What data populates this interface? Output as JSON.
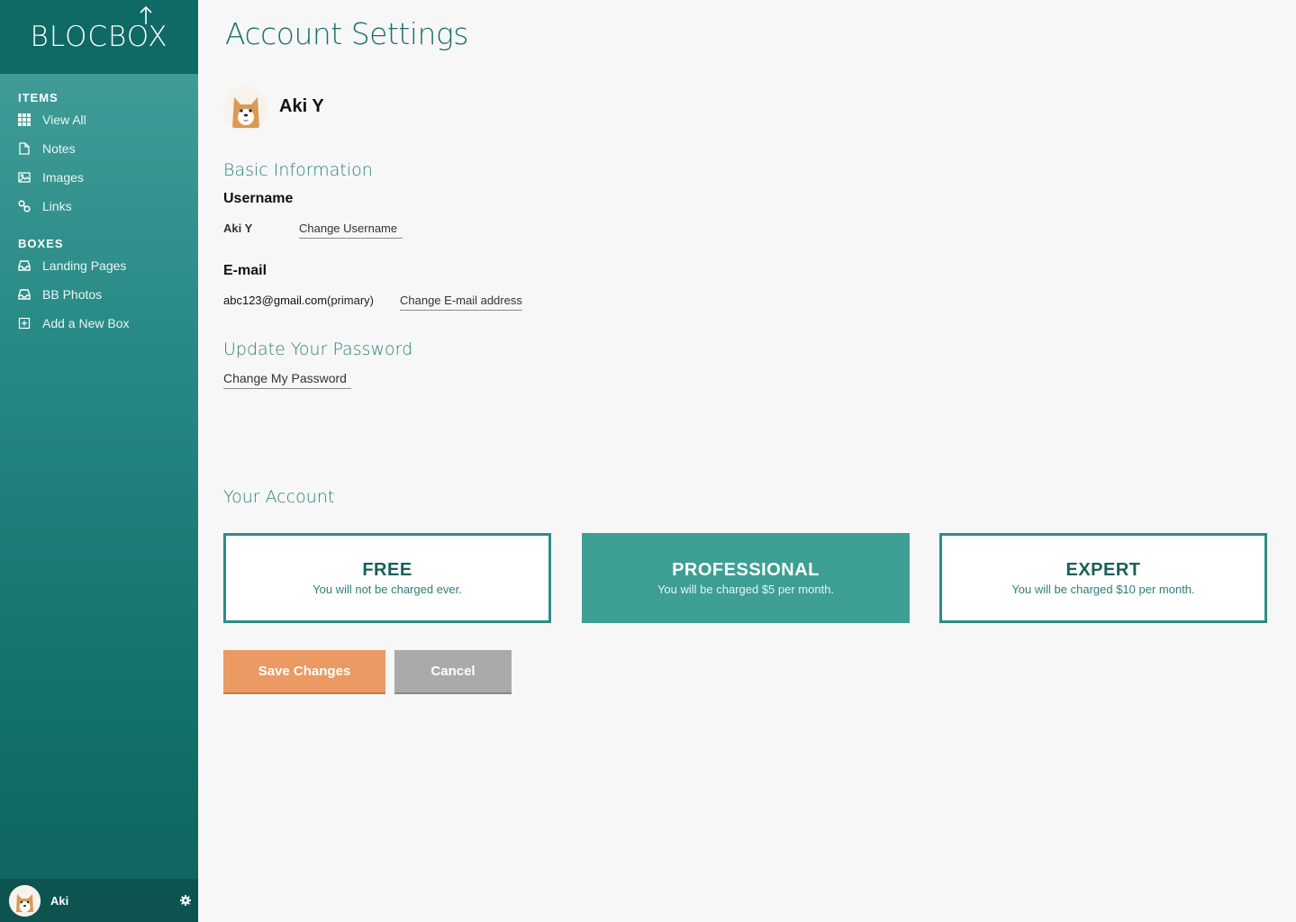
{
  "brand": {
    "name": "BLOCBOX"
  },
  "sidebar": {
    "items_heading": "ITEMS",
    "items": [
      {
        "label": "View All",
        "icon": "grid-icon"
      },
      {
        "label": "Notes",
        "icon": "document-icon"
      },
      {
        "label": "Images",
        "icon": "image-icon"
      },
      {
        "label": "Links",
        "icon": "link-icon"
      }
    ],
    "boxes_heading": "BOXES",
    "boxes": [
      {
        "label": "Landing Pages",
        "icon": "inbox-icon"
      },
      {
        "label": "BB Photos",
        "icon": "inbox-icon"
      },
      {
        "label": "Add a New Box",
        "icon": "plus-square-icon"
      }
    ],
    "user": {
      "name": "Aki",
      "settings_icon": "gear-icon"
    }
  },
  "main": {
    "title": "Account Settings",
    "profile_name": "Aki Y",
    "basic_info": {
      "heading": "Basic Information",
      "username_label": "Username",
      "username_value": "Aki Y",
      "change_username": "Change Username",
      "email_label": "E-mail",
      "email_value": "abc123@gmail.com",
      "email_note": "(primary)",
      "change_email": "Change E-mail address"
    },
    "password": {
      "heading": "Update Your Password",
      "change_password": "Change My Password"
    },
    "account": {
      "heading": "Your Account",
      "plans": [
        {
          "name": "FREE",
          "desc": "You will not be charged ever.",
          "selected": false
        },
        {
          "name": "PROFESSIONAL",
          "desc": "You will be charged $5 per month.",
          "selected": true
        },
        {
          "name": "EXPERT",
          "desc": "You will be charged $10 per month.",
          "selected": false
        }
      ]
    },
    "actions": {
      "save": "Save Changes",
      "cancel": "Cancel"
    }
  },
  "colors": {
    "accent": "#2c8d86",
    "selected_plan": "#3d9f93",
    "save_button": "#eb9a63",
    "cancel_button": "#aaaaaa"
  }
}
